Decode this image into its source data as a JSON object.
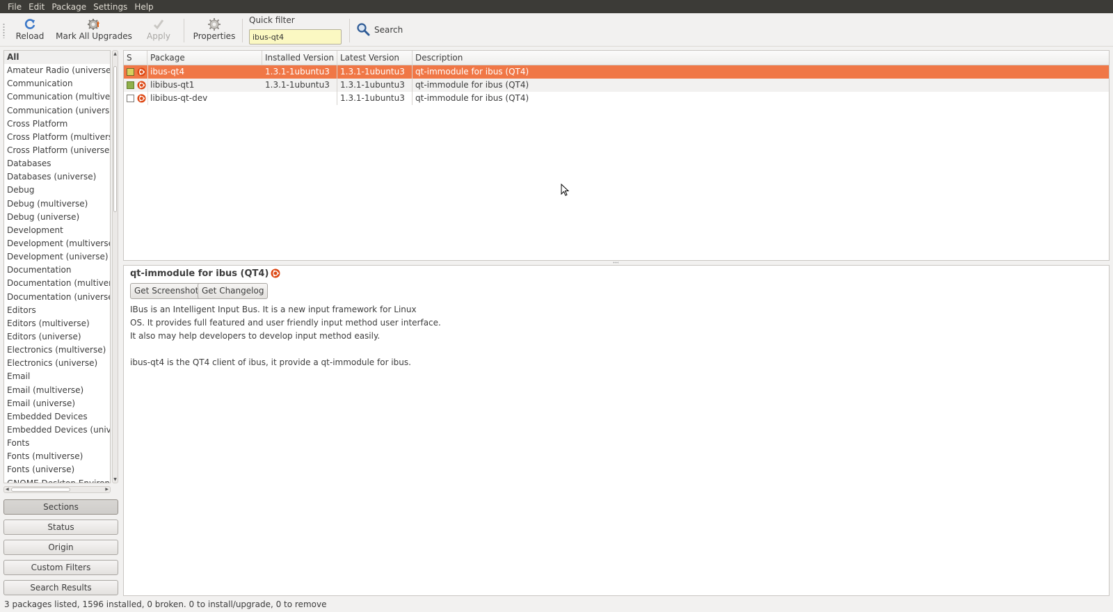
{
  "menubar": {
    "items": [
      "File",
      "Edit",
      "Package",
      "Settings",
      "Help"
    ]
  },
  "toolbar": {
    "reload": "Reload",
    "mark_all_upgrades": "Mark All Upgrades",
    "apply": "Apply",
    "properties": "Properties",
    "quick_filter_label": "Quick filter",
    "quick_filter_value": "ibus-qt4",
    "search": "Search"
  },
  "sidebar": {
    "categories": [
      "All",
      "Amateur Radio (universe)",
      "Communication",
      "Communication (multivers",
      "Communication (universe)",
      "Cross Platform",
      "Cross Platform (multiverse",
      "Cross Platform (universe)",
      "Databases",
      "Databases (universe)",
      "Debug",
      "Debug (multiverse)",
      "Debug (universe)",
      "Development",
      "Development (multiverse)",
      "Development (universe)",
      "Documentation",
      "Documentation (multiverse",
      "Documentation (universe)",
      "Editors",
      "Editors (multiverse)",
      "Editors (universe)",
      "Electronics (multiverse)",
      "Electronics (universe)",
      "Email",
      "Email (multiverse)",
      "Email (universe)",
      "Embedded Devices",
      "Embedded Devices (univers",
      "Fonts",
      "Fonts (multiverse)",
      "Fonts (universe)",
      "GNOME Desktop Environm"
    ],
    "selected": "All",
    "filter_buttons": [
      "Sections",
      "Status",
      "Origin",
      "Custom Filters",
      "Search Results"
    ]
  },
  "table": {
    "columns": [
      "S",
      "Package",
      "Installed Version",
      "Latest Version",
      "Description"
    ],
    "rows": [
      {
        "status": "installed",
        "package": "ibus-qt4",
        "installed": "1.3.1-1ubuntu3",
        "latest": "1.3.1-1ubuntu3",
        "description": "qt-immodule for ibus (QT4)",
        "selected": true
      },
      {
        "status": "installed",
        "package": "libibus-qt1",
        "installed": "1.3.1-1ubuntu3",
        "latest": "1.3.1-1ubuntu3",
        "description": "qt-immodule for ibus (QT4)",
        "selected": false
      },
      {
        "status": "not-installed",
        "package": "libibus-qt-dev",
        "installed": "",
        "latest": "1.3.1-1ubuntu3",
        "description": "qt-immodule for ibus (QT4)",
        "selected": false
      }
    ]
  },
  "details": {
    "title": "qt-immodule for ibus (QT4)",
    "get_screenshot": "Get Screenshot",
    "get_changelog": "Get Changelog",
    "description_lines": [
      "IBus is an Intelligent Input Bus. It is a new input framework for Linux",
      "OS. It provides full featured and user friendly input method user interface.",
      "It also may help developers to develop input method easily.",
      "",
      "ibus-qt4 is the QT4 client of ibus, it provide a qt-immodule for ibus."
    ]
  },
  "statusbar": {
    "text": "3 packages listed, 1596 installed, 0 broken. 0 to install/upgrade, 0 to remove"
  },
  "colors": {
    "selection": "#f07746",
    "menubar_bg": "#3c3b37",
    "quick_filter_bg": "#fbf8c2",
    "ubuntu_red": "#dd4814",
    "installed_green": "#8fb04a"
  }
}
